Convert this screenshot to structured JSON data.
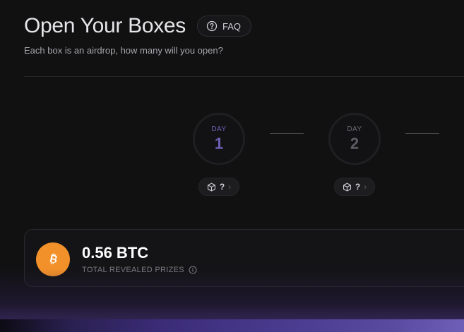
{
  "header": {
    "title": "Open Your Boxes",
    "faq_label": "FAQ",
    "subtitle": "Each box is an airdrop, how many will you open?"
  },
  "days": [
    {
      "label": "DAY",
      "number": "1",
      "active": true,
      "boxes": "?"
    },
    {
      "label": "DAY",
      "number": "2",
      "active": false,
      "boxes": "?"
    }
  ],
  "prize": {
    "amount": "0.56 BTC",
    "caption": "TOTAL REVEALED PRIZES",
    "icon": "bitcoin-icon"
  },
  "colors": {
    "accent": "#6d5fb3",
    "bitcoin": "#f2912a",
    "background": "#111112"
  }
}
